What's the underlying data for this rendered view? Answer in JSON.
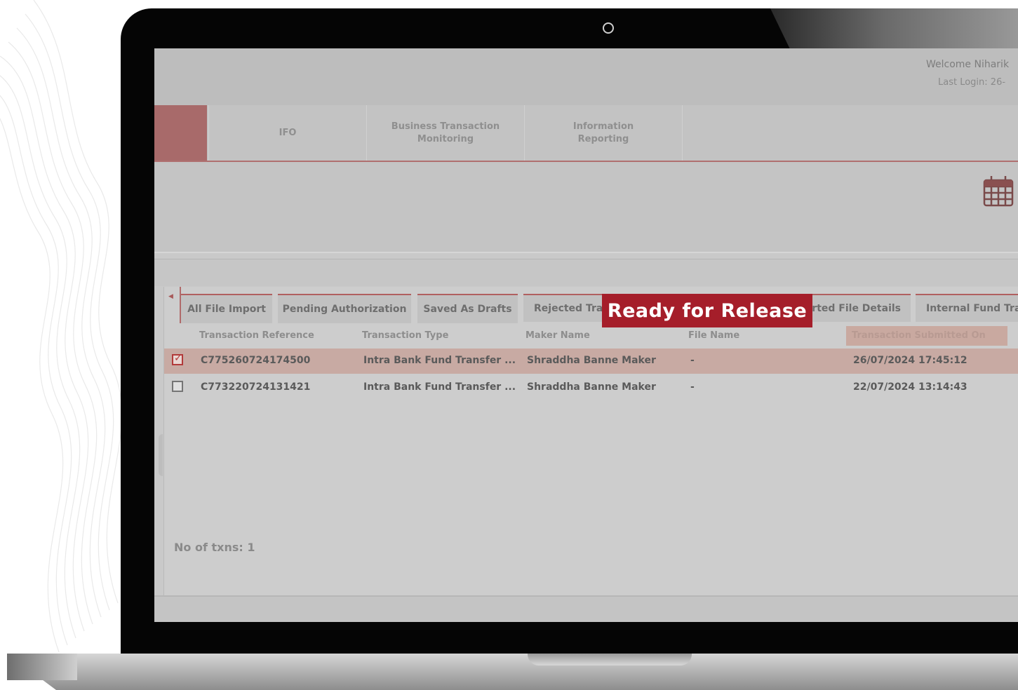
{
  "header": {
    "welcome": "Welcome Niharik",
    "last_login": "Last Login: 26-"
  },
  "nav": {
    "items": [
      {
        "label_line1": "IFO",
        "label_line2": ""
      },
      {
        "label_line1": "Business Transaction",
        "label_line2": "Monitoring"
      },
      {
        "label_line1": "Information",
        "label_line2": "Reporting"
      }
    ]
  },
  "toolbar": {
    "calendar_icon": "calendar-icon"
  },
  "tabs": [
    "All File Import",
    "Pending Authorization",
    "Saved As Drafts",
    "Rejected Tran",
    "orted File Details",
    "Internal Fund Tran"
  ],
  "overlay_badge": "Ready for Release",
  "table": {
    "columns": [
      "Transaction Reference",
      "Transaction Type",
      "Maker Name",
      "File Name",
      "Transaction Submitted On"
    ],
    "rows": [
      {
        "selected": true,
        "reference": "C775260724174500",
        "type": "Intra Bank Fund Transfer ...",
        "maker": "Shraddha Banne Maker",
        "file": "-",
        "submitted": "26/07/2024 17:45:12"
      },
      {
        "selected": false,
        "reference": "C773220724131421",
        "type": "Intra Bank Fund Transfer ...",
        "maker": "Shraddha Banne Maker",
        "file": "-",
        "submitted": "22/07/2024 13:14:43"
      }
    ]
  },
  "summary": {
    "txn_count": "No of txns: 1"
  },
  "colors": {
    "accent": "#a51e2a",
    "selected_row": "#c8aaa3",
    "nav_active": "#a86a6a"
  }
}
